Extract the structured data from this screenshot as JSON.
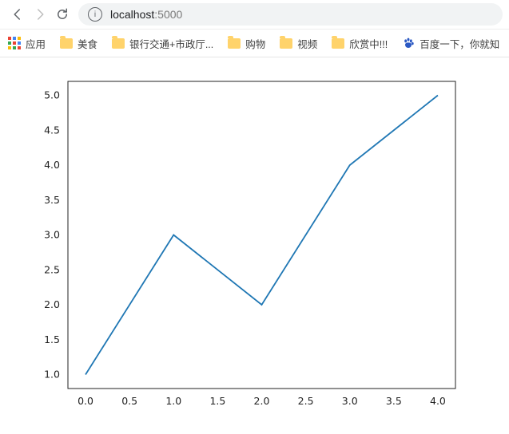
{
  "toolbar": {
    "back_icon": "back",
    "forward_icon": "forward",
    "reload_icon": "reload",
    "address": {
      "info": "i",
      "host": "localhost",
      "port": ":5000"
    }
  },
  "bookmarks": {
    "apps_label": "应用",
    "items": [
      {
        "label": "美食"
      },
      {
        "label": "银行交通+市政厅..."
      },
      {
        "label": "购物"
      },
      {
        "label": "视频"
      },
      {
        "label": "欣赏中!!!"
      }
    ],
    "baidu": {
      "label": "百度一下，你就知"
    }
  },
  "chart_data": {
    "type": "line",
    "x": [
      0,
      1,
      2,
      3,
      4
    ],
    "y": [
      1,
      3,
      2,
      4,
      5
    ],
    "title": "",
    "xlabel": "",
    "ylabel": "",
    "xlim": [
      -0.2,
      4.2
    ],
    "ylim": [
      0.8,
      5.2
    ],
    "xticks": [
      0.0,
      0.5,
      1.0,
      1.5,
      2.0,
      2.5,
      3.0,
      3.5,
      4.0
    ],
    "yticks": [
      1.0,
      1.5,
      2.0,
      2.5,
      3.0,
      3.5,
      4.0,
      4.5,
      5.0
    ],
    "xtick_labels": [
      "0.0",
      "0.5",
      "1.0",
      "1.5",
      "2.0",
      "2.5",
      "3.0",
      "3.5",
      "4.0"
    ],
    "ytick_labels": [
      "1.0",
      "1.5",
      "2.0",
      "2.5",
      "3.0",
      "3.5",
      "4.0",
      "4.5",
      "5.0"
    ]
  },
  "app_colors": [
    "#ea4335",
    "#4285f4",
    "#fbbc05",
    "#34a853",
    "#ea4335",
    "#4285f4",
    "#fbbc05",
    "#34a853",
    "#ea4335"
  ]
}
